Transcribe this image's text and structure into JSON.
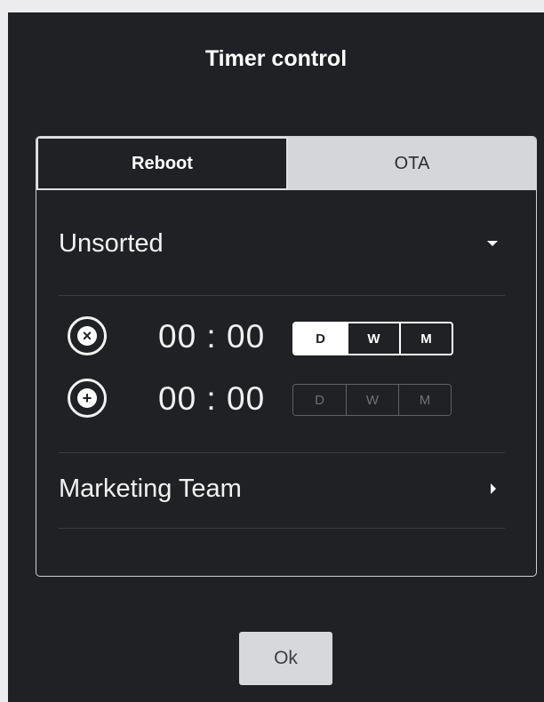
{
  "dialog": {
    "title": "Timer control",
    "ok_label": "Ok"
  },
  "tabs": [
    {
      "label": "Reboot",
      "active": true
    },
    {
      "label": "OTA",
      "active": false
    }
  ],
  "groups": [
    {
      "name": "Unsorted",
      "expanded": true
    },
    {
      "name": "Marketing Team",
      "expanded": false
    }
  ],
  "timers": [
    {
      "action_icon": "close-x-icon",
      "time": "00 : 00",
      "enabled": true,
      "frequency": [
        {
          "label": "D",
          "selected": false
        },
        {
          "label": "W",
          "selected": true
        },
        {
          "label": "M",
          "selected": true
        }
      ]
    },
    {
      "action_icon": "plus-icon",
      "time": "00 : 00",
      "enabled": false,
      "frequency": [
        {
          "label": "D",
          "selected": false
        },
        {
          "label": "W",
          "selected": false
        },
        {
          "label": "M",
          "selected": false
        }
      ]
    }
  ]
}
